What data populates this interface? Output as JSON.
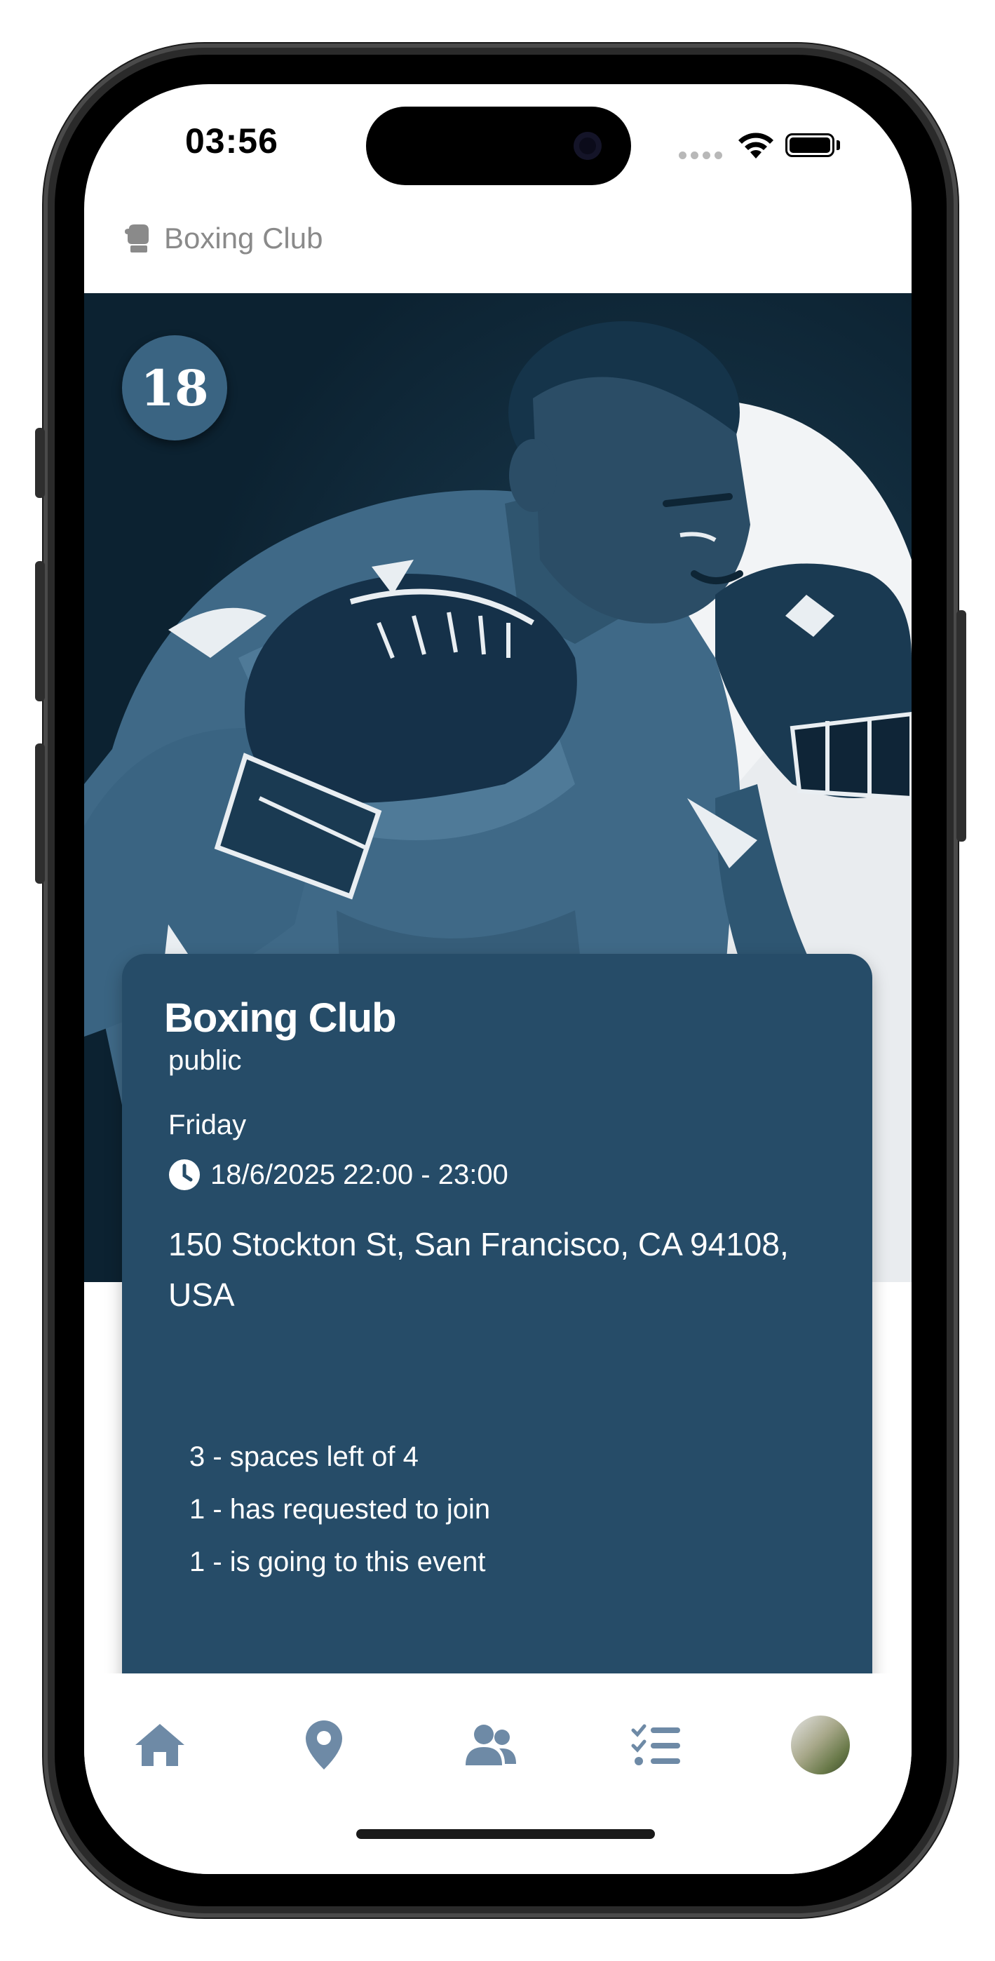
{
  "status_bar": {
    "time": "03:56"
  },
  "header": {
    "club_name": "Boxing Club",
    "icon": "boxing-glove-icon"
  },
  "hero": {
    "day_number": "18"
  },
  "event": {
    "title": "Boxing Club",
    "visibility": "public",
    "weekday": "Friday",
    "datetime": "18/6/2025 22:00 - 23:00",
    "address": "150 Stockton St, San Francisco, CA 94108, USA",
    "spaces_left": "3 - spaces left of 4",
    "requested": "1 - has requested to join",
    "going": "1 - is going to this event"
  },
  "nav": {
    "items": [
      {
        "name": "home",
        "icon": "home-icon"
      },
      {
        "name": "location",
        "icon": "map-pin-icon"
      },
      {
        "name": "people",
        "icon": "people-icon"
      },
      {
        "name": "tasks",
        "icon": "checklist-icon"
      },
      {
        "name": "profile",
        "icon": "avatar"
      }
    ]
  },
  "colors": {
    "card": "#264c68",
    "hero_dark": "#0f2a3b",
    "nav_icon": "#6e8aa6",
    "badge": "#3a6482"
  }
}
